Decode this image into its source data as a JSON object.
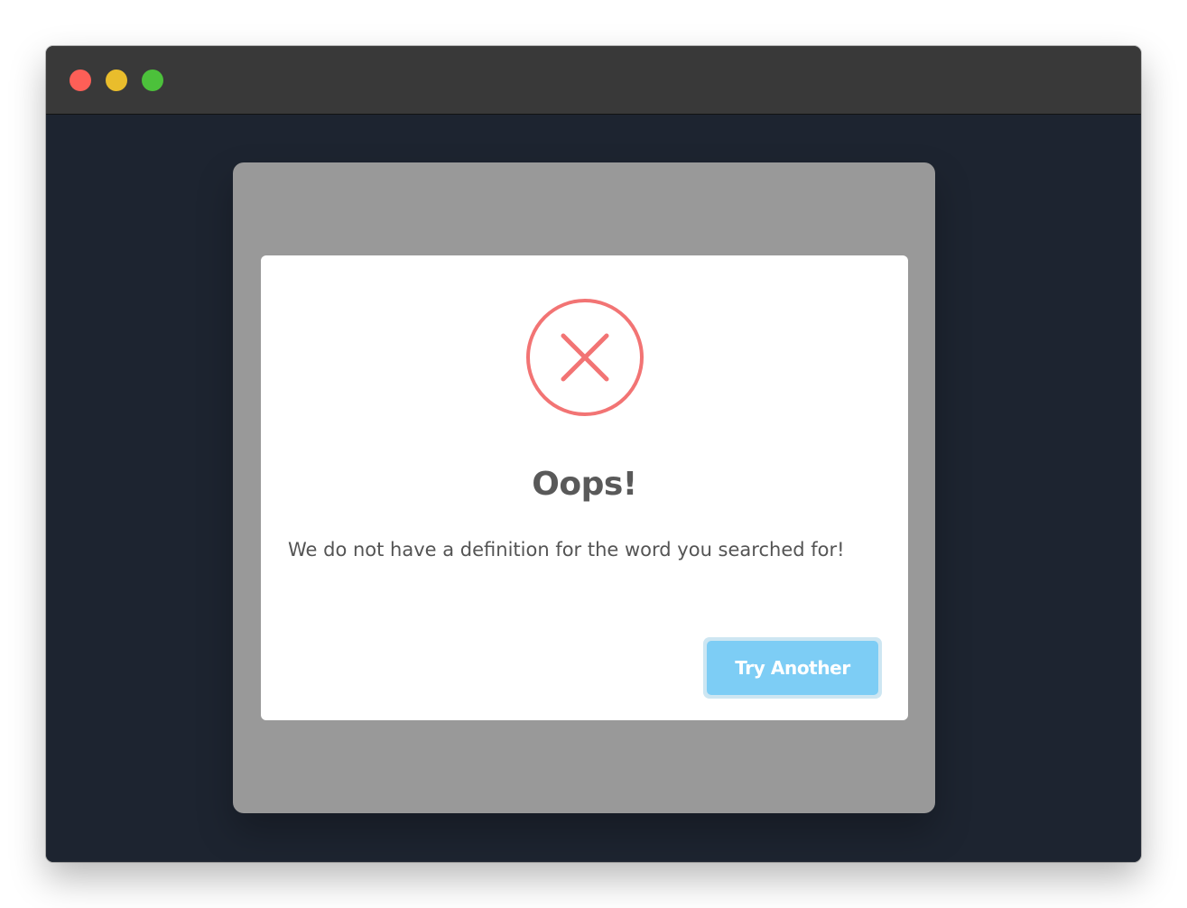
{
  "window": {
    "controls": {
      "close_color": "#fe5f57",
      "minimize_color": "#febc2e",
      "zoom_color": "#28c840"
    }
  },
  "dialog": {
    "icon": "error-x-circle-icon",
    "icon_color": "#f27474",
    "title": "Oops!",
    "message": "We do not have a definition for the word you searched for!",
    "button_label": "Try Another",
    "button_color": "#7dcdf5"
  }
}
